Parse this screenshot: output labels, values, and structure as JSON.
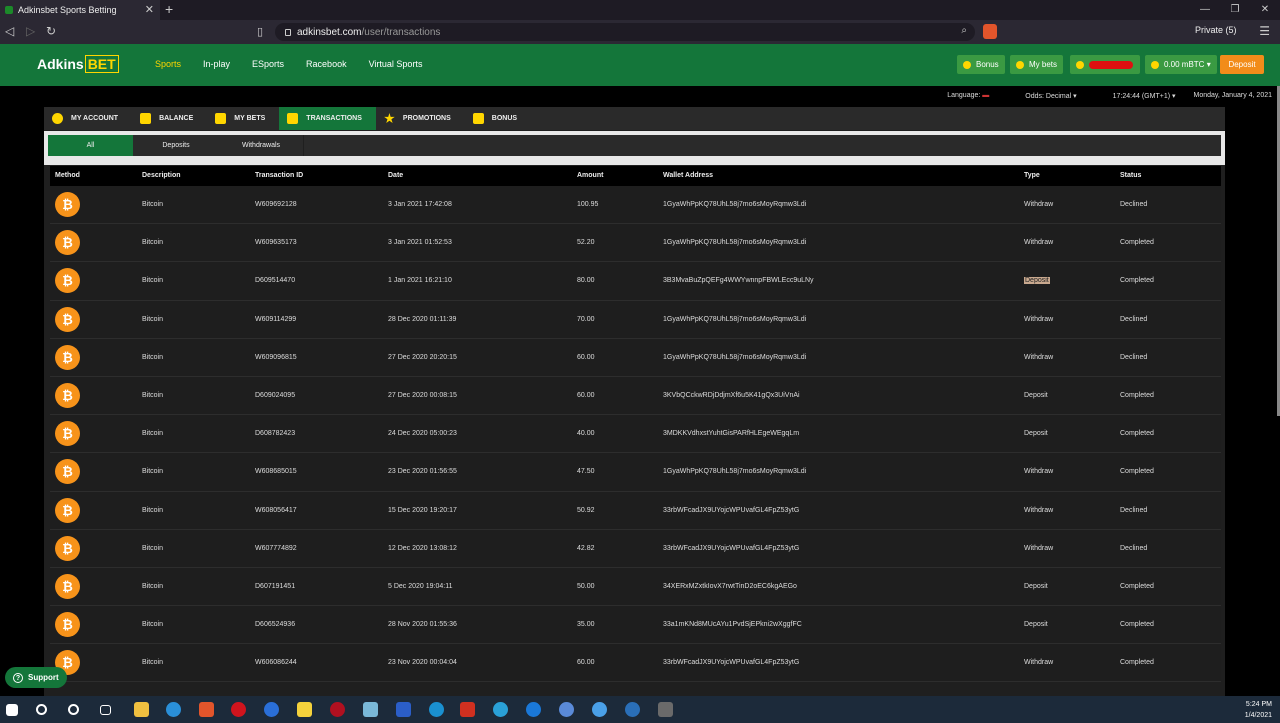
{
  "browser": {
    "tab_title": "Adkinsbet Sports Betting",
    "url_host": "adkinsbet.com",
    "url_path": "/user/transactions",
    "private_label": "Private (5)"
  },
  "site": {
    "logo_text": "Adkins",
    "logo_bet": "BET",
    "nav": [
      "Sports",
      "In-play",
      "ESports",
      "Racebook",
      "Virtual Sports"
    ],
    "bonus_label": "Bonus",
    "mybets_label": "My bets",
    "balance_label": "0.00 mBTC",
    "deposit_label": "Deposit",
    "colors": {
      "header": "#14763a",
      "accent": "#ffd600",
      "deposit": "#f28c1a",
      "bitcoin": "#f7931a"
    }
  },
  "infobar": {
    "language": "Language:",
    "odds": "Odds: Decimal",
    "time": "17:24:44 (GMT+1)",
    "date": "Monday, January 4, 2021"
  },
  "account_tabs": [
    "MY ACCOUNT",
    "BALANCE",
    "MY BETS",
    "TRANSACTIONS",
    "PROMOTIONS",
    "BONUS"
  ],
  "sub_tabs": [
    "All",
    "Deposits",
    "Withdrawals"
  ],
  "table": {
    "headers": [
      "Method",
      "Description",
      "Transaction ID",
      "Date",
      "Amount",
      "Wallet Address",
      "Type",
      "Status"
    ],
    "rows": [
      {
        "desc": "Bitcoin",
        "id": "W609692128",
        "date": "3 Jan 2021 17:42:08",
        "amount": "100.95",
        "wallet": "1GyaWhPpKQ78UhL58j7mo6sMoyRqmw3Ldi",
        "type": "Withdraw",
        "status": "Declined"
      },
      {
        "desc": "Bitcoin",
        "id": "W609635173",
        "date": "3 Jan 2021 01:52:53",
        "amount": "52.20",
        "wallet": "1GyaWhPpKQ78UhL58j7mo6sMoyRqmw3Ldi",
        "type": "Withdraw",
        "status": "Completed"
      },
      {
        "desc": "Bitcoin",
        "id": "D609514470",
        "date": "1 Jan 2021 16:21:10",
        "amount": "80.00",
        "wallet": "3B3MvaBuZpQEFg4WWYwnnpFBWLEcc9uLNy",
        "type": "Deposit",
        "status": "Completed"
      },
      {
        "desc": "Bitcoin",
        "id": "W609114299",
        "date": "28 Dec 2020 01:11:39",
        "amount": "70.00",
        "wallet": "1GyaWhPpKQ78UhL58j7mo6sMoyRqmw3Ldi",
        "type": "Withdraw",
        "status": "Declined"
      },
      {
        "desc": "Bitcoin",
        "id": "W609096815",
        "date": "27 Dec 2020 20:20:15",
        "amount": "60.00",
        "wallet": "1GyaWhPpKQ78UhL58j7mo6sMoyRqmw3Ldi",
        "type": "Withdraw",
        "status": "Declined"
      },
      {
        "desc": "Bitcoin",
        "id": "D609024095",
        "date": "27 Dec 2020 00:08:15",
        "amount": "60.00",
        "wallet": "3KVbQCckwRDjDdjmXf6u5K41gQx3UiVnAi",
        "type": "Deposit",
        "status": "Completed"
      },
      {
        "desc": "Bitcoin",
        "id": "D608782423",
        "date": "24 Dec 2020 05:00:23",
        "amount": "40.00",
        "wallet": "3MDKKVdhxstYuhtGisPARfHLEgeWEgqLm",
        "type": "Deposit",
        "status": "Completed"
      },
      {
        "desc": "Bitcoin",
        "id": "W608685015",
        "date": "23 Dec 2020 01:56:55",
        "amount": "47.50",
        "wallet": "1GyaWhPpKQ78UhL58j7mo6sMoyRqmw3Ldi",
        "type": "Withdraw",
        "status": "Completed"
      },
      {
        "desc": "Bitcoin",
        "id": "W608056417",
        "date": "15 Dec 2020 19:20:17",
        "amount": "50.92",
        "wallet": "33rbWFcadJX9UYojcWPUvafGL4FpZ53ytG",
        "type": "Withdraw",
        "status": "Declined"
      },
      {
        "desc": "Bitcoin",
        "id": "W607774892",
        "date": "12 Dec 2020 13:08:12",
        "amount": "42.82",
        "wallet": "33rbWFcadJX9UYojcWPUvafGL4FpZ53ytG",
        "type": "Withdraw",
        "status": "Declined"
      },
      {
        "desc": "Bitcoin",
        "id": "D607191451",
        "date": "5 Dec 2020 19:04:11",
        "amount": "50.00",
        "wallet": "34XERxMZxtkIovX7rwtTinD2oEC6kgAEGo",
        "type": "Deposit",
        "status": "Completed"
      },
      {
        "desc": "Bitcoin",
        "id": "D606524936",
        "date": "28 Nov 2020 01:55:36",
        "amount": "35.00",
        "wallet": "33a1mKNd8MUcAYu1PvdSjEPkni2wXggfFC",
        "type": "Deposit",
        "status": "Completed"
      },
      {
        "desc": "Bitcoin",
        "id": "W606086244",
        "date": "23 Nov 2020 00:04:04",
        "amount": "60.00",
        "wallet": "33rbWFcadJX9UYojcWPUvafGL4FpZ53ytG",
        "type": "Withdraw",
        "status": "Completed"
      }
    ]
  },
  "support_label": "Support",
  "taskbar": {
    "time": "5:24 PM",
    "date": "1/4/2021"
  }
}
